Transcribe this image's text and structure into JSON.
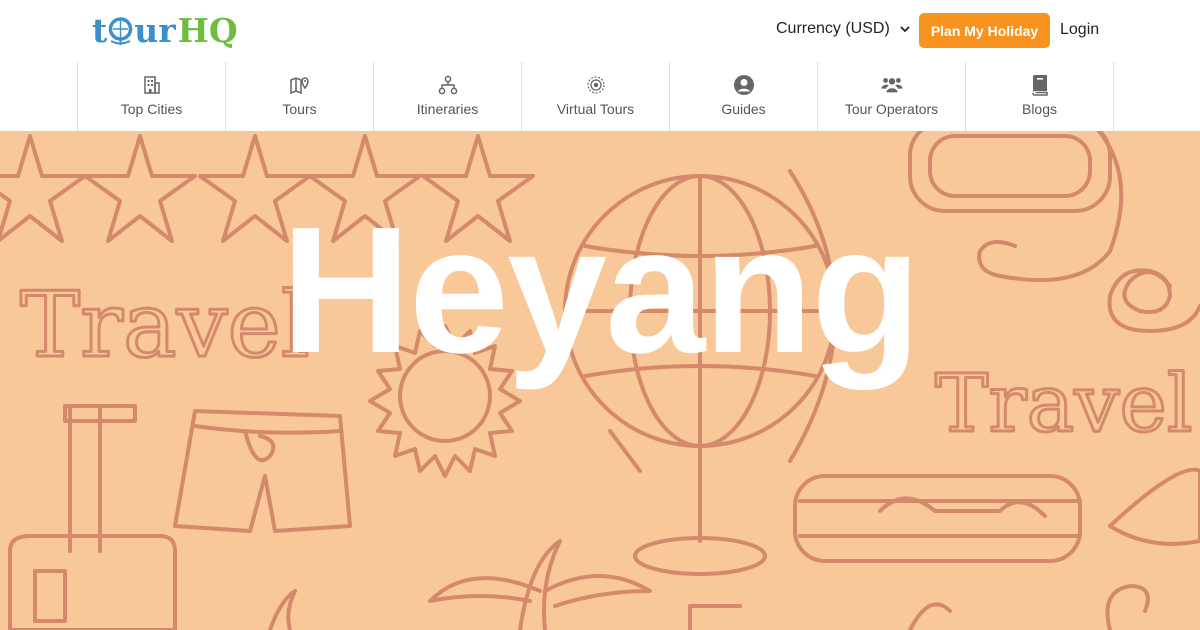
{
  "brand": {
    "logo_text_start": "t",
    "logo_text_mid": "ur",
    "logo_text_end": "HQ"
  },
  "header": {
    "currency_label": "Currency (USD)",
    "plan_button": "Plan My Holiday",
    "login_label": "Login"
  },
  "nav": {
    "items": [
      {
        "label": "Top Cities",
        "icon": "building-icon"
      },
      {
        "label": "Tours",
        "icon": "map-pin-icon"
      },
      {
        "label": "Itineraries",
        "icon": "sitemap-icon"
      },
      {
        "label": "Virtual Tours",
        "icon": "target-icon"
      },
      {
        "label": "Guides",
        "icon": "user-circle-icon"
      },
      {
        "label": "Tour Operators",
        "icon": "users-icon"
      },
      {
        "label": "Blogs",
        "icon": "book-icon"
      }
    ]
  },
  "hero": {
    "title": "Heyang",
    "doodle_words": [
      "Travel",
      "Travel"
    ]
  },
  "colors": {
    "brand_blue": "#3d8fc9",
    "brand_green": "#6ebd3c",
    "accent_orange": "#f7931e",
    "hero_bg": "#f9c899",
    "doodle_stroke": "#d4896b"
  }
}
